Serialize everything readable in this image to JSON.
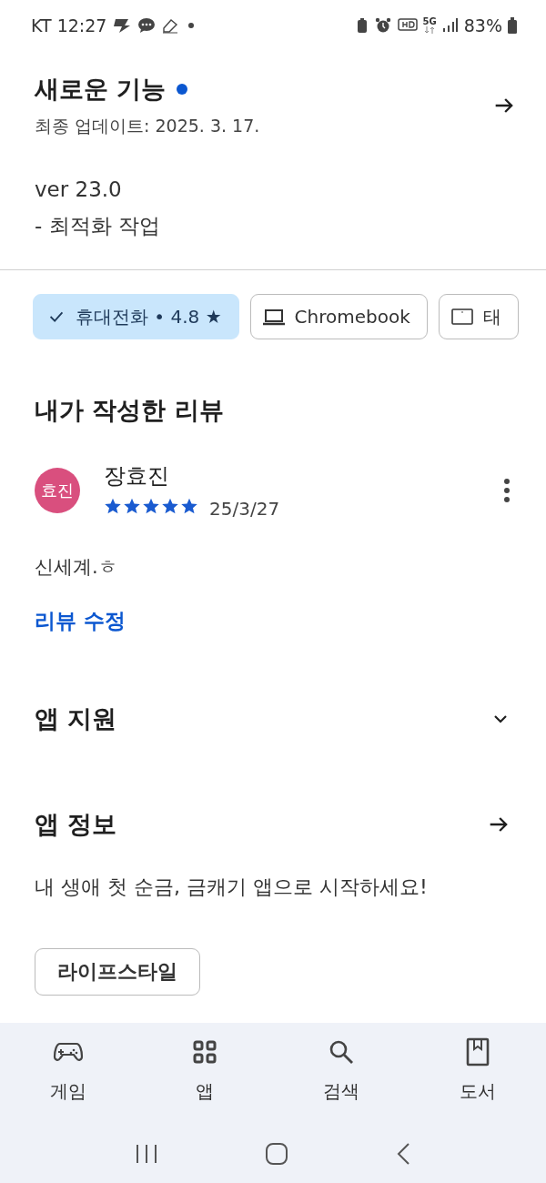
{
  "status_bar": {
    "carrier_time": "KT 12:27",
    "network": "5G",
    "battery": "83%"
  },
  "whats_new": {
    "title": "새로운 기능",
    "unread": true,
    "updated": "최종 업데이트: 2025. 3. 17.",
    "version": "ver 23.0",
    "notes": "- 최적화 작업"
  },
  "device_chips": [
    {
      "label": "휴대전화 • 4.8 ★",
      "selected": true
    },
    {
      "kind": "laptop",
      "label": "Chromebook",
      "selected": false
    },
    {
      "kind": "tablet",
      "label": "태",
      "selected": false
    }
  ],
  "my_review": {
    "heading": "내가 작성한 리뷰",
    "avatar": "효진",
    "author": "장효진",
    "stars": 5,
    "date": "25/3/27",
    "text": "신세계.ㅎ",
    "edit_link": "리뷰 수정"
  },
  "sections": [
    {
      "title": "앱 지원",
      "kind": "expand",
      "expanded": false
    },
    {
      "title": "앱 정보",
      "kind": "arrow"
    }
  ],
  "app_description": "내 생애 첫 순금, 금캐기 앱으로 시작하세요!",
  "category_tag": "라이프스타일",
  "bottom_nav": [
    {
      "kind": "games",
      "label": "게임",
      "selected": false
    },
    {
      "kind": "apps",
      "label": "앱",
      "selected": false
    },
    {
      "kind": "search",
      "label": "검색",
      "selected": false
    },
    {
      "kind": "books",
      "label": "도서",
      "selected": false
    }
  ]
}
